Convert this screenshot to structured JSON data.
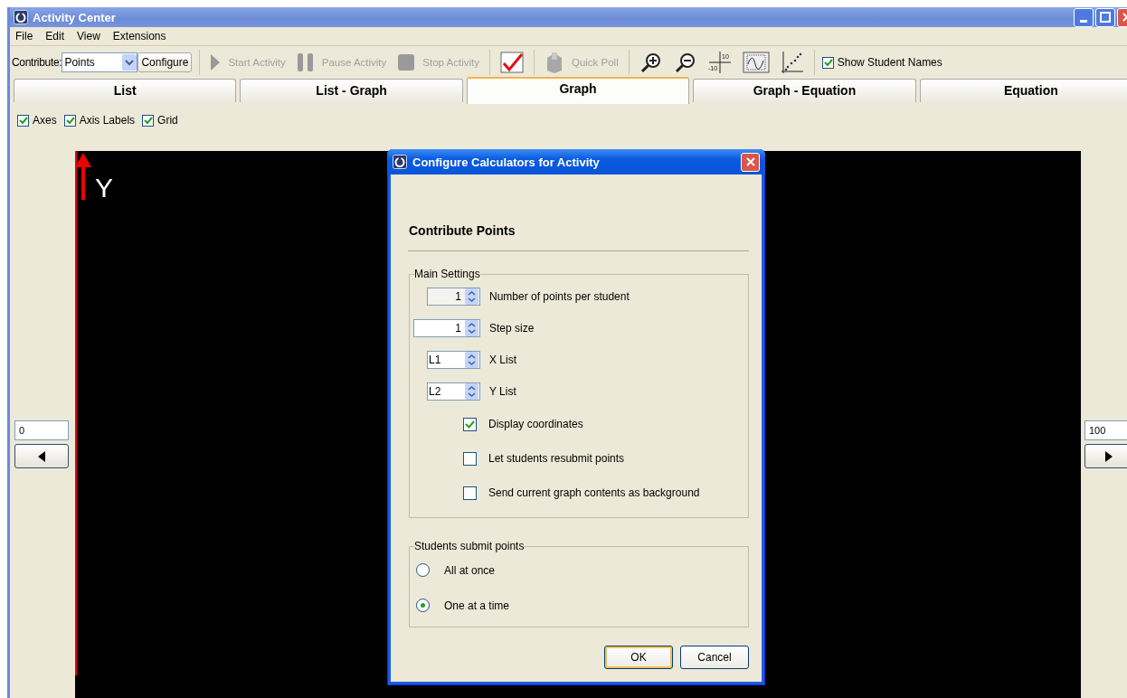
{
  "window": {
    "title": "Activity Center"
  },
  "menu": [
    "File",
    "Edit",
    "View",
    "Extensions"
  ],
  "toolbar": {
    "contribute_label": "Contribute:",
    "contribute_value": "Points",
    "configure": "Configure",
    "start": {
      "label": "Start Activity",
      "disabled": true
    },
    "pause": {
      "label": "Pause Activity",
      "disabled": true
    },
    "stop": {
      "label": "Stop Activity",
      "disabled": true
    },
    "quick_poll": {
      "label": "Quick Poll",
      "disabled": true
    },
    "axis_tick_labels": [
      "10",
      "-10"
    ],
    "show_student_names": {
      "label": "Show Student Names",
      "checked": true
    }
  },
  "tabs": [
    {
      "label": "List",
      "selected": false
    },
    {
      "label": "List - Graph",
      "selected": false
    },
    {
      "label": "Graph",
      "selected": true
    },
    {
      "label": "Graph - Equation",
      "selected": false
    },
    {
      "label": "Equation",
      "selected": false
    }
  ],
  "graph_options": [
    {
      "label": "Axes",
      "checked": true
    },
    {
      "label": "Axis Labels",
      "checked": true
    },
    {
      "label": "Grid",
      "checked": true
    }
  ],
  "graph": {
    "y_label": "Y",
    "x_min": "0",
    "x_max": "100"
  },
  "dialog": {
    "title": "Configure Calculators for Activity",
    "heading": "Contribute Points",
    "main_settings": {
      "legend": "Main Settings",
      "spinners": [
        {
          "kind": "number",
          "value": "1",
          "label": "Number of points per student",
          "disabled": true
        },
        {
          "kind": "number",
          "value": "1",
          "label": "Step size",
          "disabled": false
        },
        {
          "kind": "list",
          "value": "L1",
          "label": "X List",
          "disabled": false
        },
        {
          "kind": "list",
          "value": "L2",
          "label": "Y List",
          "disabled": false
        }
      ],
      "checkboxes": [
        {
          "label": "Display coordinates",
          "checked": true
        },
        {
          "label": "Let students resubmit points",
          "checked": false
        },
        {
          "label": "Send current graph contents as background",
          "checked": false
        }
      ]
    },
    "submit": {
      "legend": "Students submit points",
      "options": [
        {
          "label": "All at once",
          "selected": false
        },
        {
          "label": "One at a time",
          "selected": true
        }
      ]
    },
    "buttons": [
      {
        "label": "OK",
        "default": true
      },
      {
        "label": "Cancel",
        "default": false
      }
    ]
  }
}
